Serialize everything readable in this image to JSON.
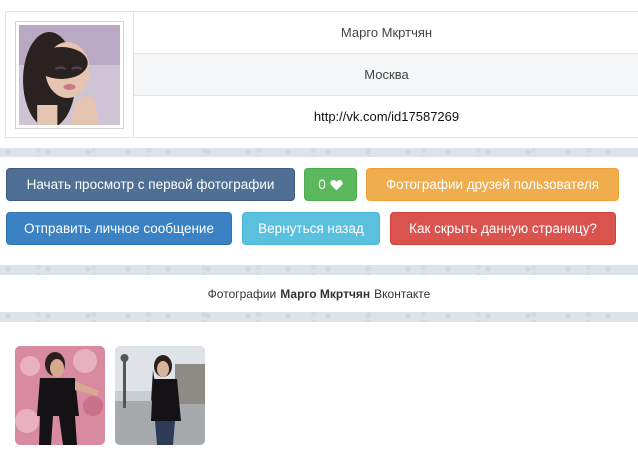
{
  "profile": {
    "name": "Марго Мкртчян",
    "city": "Москва",
    "link": "http://vk.com/id17587269"
  },
  "buttons": {
    "start_view": "Начать просмотр с первой фотографии",
    "likes_count": "0",
    "friends_photos": "Фотографии друзей пользователя",
    "send_message": "Отправить личное сообщение",
    "go_back": "Вернуться назад",
    "hide_page": "Как скрыть данную страницу?"
  },
  "caption": {
    "prefix": "Фотографии",
    "name": "Марго Мкртчян",
    "suffix": "Вконтакте"
  },
  "colors": {
    "dark": "#4f6f95",
    "green": "#5cb85c",
    "orange": "#f0ad4e",
    "blue": "#3b82c4",
    "cyan": "#5bc0de",
    "red": "#d9534f"
  },
  "icons": {
    "likes": "heart-icon"
  }
}
